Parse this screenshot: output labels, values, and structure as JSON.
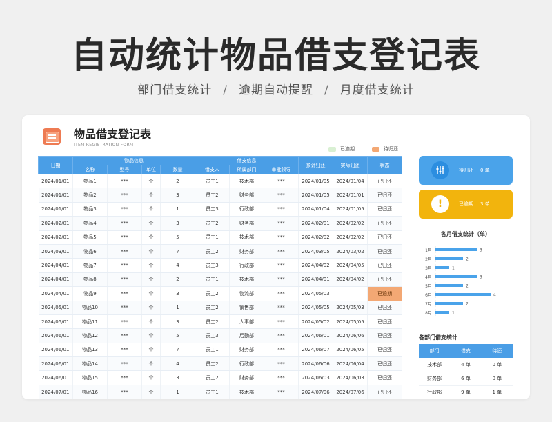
{
  "hero": {
    "title": "自动统计物品借支登记表",
    "subtitles": [
      "部门借支统计",
      "逾期自动提醒",
      "月度借支统计"
    ],
    "separator": "/"
  },
  "card": {
    "title": "物品借支登记表",
    "subtitle": "ITEM REGISTRATION FORM",
    "legend": [
      {
        "label": "已逾期",
        "color": "#d9f0d3"
      },
      {
        "label": "待归还",
        "color": "#f3a874"
      }
    ]
  },
  "table": {
    "group_headers": {
      "item_info": "物品信息",
      "borrow_info": "借支信息"
    },
    "headers": {
      "date": "日期",
      "name": "名称",
      "model": "型号",
      "unit": "单位",
      "qty": "数量",
      "borrower": "借支人",
      "dept": "所属部门",
      "approver": "审批领导",
      "due": "预计归还",
      "returned": "实际归还",
      "status": "状态"
    },
    "rows": [
      {
        "date": "2024/01/01",
        "name": "物品1",
        "model": "***",
        "unit": "个",
        "qty": "2",
        "borrower": "员工1",
        "dept": "技术部",
        "approver": "***",
        "due": "2024/01/05",
        "returned": "2024/01/04",
        "status": "已归还"
      },
      {
        "date": "2024/01/01",
        "name": "物品2",
        "model": "***",
        "unit": "个",
        "qty": "3",
        "borrower": "员工2",
        "dept": "财务部",
        "approver": "***",
        "due": "2024/01/05",
        "returned": "2024/01/01",
        "status": "已归还"
      },
      {
        "date": "2024/01/01",
        "name": "物品3",
        "model": "***",
        "unit": "个",
        "qty": "1",
        "borrower": "员工3",
        "dept": "行政部",
        "approver": "***",
        "due": "2024/01/04",
        "returned": "2024/01/05",
        "status": "已归还"
      },
      {
        "date": "2024/02/01",
        "name": "物品4",
        "model": "***",
        "unit": "个",
        "qty": "3",
        "borrower": "员工2",
        "dept": "财务部",
        "approver": "***",
        "due": "2024/02/01",
        "returned": "2024/02/02",
        "status": "已归还"
      },
      {
        "date": "2024/02/01",
        "name": "物品5",
        "model": "***",
        "unit": "个",
        "qty": "5",
        "borrower": "员工1",
        "dept": "技术部",
        "approver": "***",
        "due": "2024/02/02",
        "returned": "2024/02/02",
        "status": "已归还"
      },
      {
        "date": "2024/03/01",
        "name": "物品6",
        "model": "***",
        "unit": "个",
        "qty": "7",
        "borrower": "员工2",
        "dept": "财务部",
        "approver": "***",
        "due": "2024/03/05",
        "returned": "2024/03/02",
        "status": "已归还"
      },
      {
        "date": "2024/04/01",
        "name": "物品7",
        "model": "***",
        "unit": "个",
        "qty": "4",
        "borrower": "员工3",
        "dept": "行政部",
        "approver": "***",
        "due": "2024/04/02",
        "returned": "2024/04/05",
        "status": "已归还"
      },
      {
        "date": "2024/04/01",
        "name": "物品8",
        "model": "***",
        "unit": "个",
        "qty": "2",
        "borrower": "员工1",
        "dept": "技术部",
        "approver": "***",
        "due": "2024/04/01",
        "returned": "2024/04/02",
        "status": "已归还"
      },
      {
        "date": "2024/04/01",
        "name": "物品9",
        "model": "***",
        "unit": "个",
        "qty": "3",
        "borrower": "员工2",
        "dept": "物流部",
        "approver": "***",
        "due": "2024/05/03",
        "returned": "",
        "status": "已逾期"
      },
      {
        "date": "2024/05/01",
        "name": "物品10",
        "model": "***",
        "unit": "个",
        "qty": "1",
        "borrower": "员工2",
        "dept": "销售部",
        "approver": "***",
        "due": "2024/05/05",
        "returned": "2024/05/03",
        "status": "已归还"
      },
      {
        "date": "2024/05/01",
        "name": "物品11",
        "model": "***",
        "unit": "个",
        "qty": "3",
        "borrower": "员工2",
        "dept": "人事部",
        "approver": "***",
        "due": "2024/05/02",
        "returned": "2024/05/05",
        "status": "已归还"
      },
      {
        "date": "2024/06/01",
        "name": "物品12",
        "model": "***",
        "unit": "个",
        "qty": "5",
        "borrower": "员工3",
        "dept": "后勤部",
        "approver": "***",
        "due": "2024/06/01",
        "returned": "2024/06/06",
        "status": "已归还"
      },
      {
        "date": "2024/06/01",
        "name": "物品13",
        "model": "***",
        "unit": "个",
        "qty": "7",
        "borrower": "员工1",
        "dept": "财务部",
        "approver": "***",
        "due": "2024/06/07",
        "returned": "2024/06/05",
        "status": "已归还"
      },
      {
        "date": "2024/06/01",
        "name": "物品14",
        "model": "***",
        "unit": "个",
        "qty": "4",
        "borrower": "员工2",
        "dept": "行政部",
        "approver": "***",
        "due": "2024/06/06",
        "returned": "2024/06/04",
        "status": "已归还"
      },
      {
        "date": "2024/06/01",
        "name": "物品15",
        "model": "***",
        "unit": "个",
        "qty": "3",
        "borrower": "员工2",
        "dept": "财务部",
        "approver": "***",
        "due": "2024/06/03",
        "returned": "2024/06/03",
        "status": "已归还"
      },
      {
        "date": "2024/07/01",
        "name": "物品16",
        "model": "***",
        "unit": "个",
        "qty": "1",
        "borrower": "员工1",
        "dept": "技术部",
        "approver": "***",
        "due": "2024/07/06",
        "returned": "2024/07/06",
        "status": "已归还"
      }
    ]
  },
  "summary": {
    "pending": {
      "label": "待归还",
      "count": "0 单",
      "color": "#4aa3ea"
    },
    "overdue": {
      "label": "已逾期",
      "count": "3 单",
      "color": "#f2b40d",
      "icon": "!"
    }
  },
  "monthly": {
    "title": "各月借支统计（单）"
  },
  "chart_data": {
    "type": "bar",
    "orientation": "horizontal",
    "categories": [
      "1月",
      "2月",
      "3月",
      "4月",
      "5月",
      "6月",
      "7月",
      "8月"
    ],
    "values": [
      3,
      2,
      1,
      3,
      2,
      4,
      2,
      1
    ],
    "title": "各月借支统计（单）",
    "color": "#4aa3ea",
    "xlim": [
      0,
      4
    ]
  },
  "dept_stats": {
    "title": "各部门借支统计",
    "headers": {
      "dept": "部门",
      "borrow": "借支",
      "pending": "待还"
    },
    "rows": [
      {
        "dept": "技术部",
        "borrow": "4 单",
        "pending": "0 单"
      },
      {
        "dept": "财务部",
        "borrow": "6 单",
        "pending": "0 单"
      },
      {
        "dept": "行政部",
        "borrow": "9 单",
        "pending": "1 单"
      }
    ]
  }
}
